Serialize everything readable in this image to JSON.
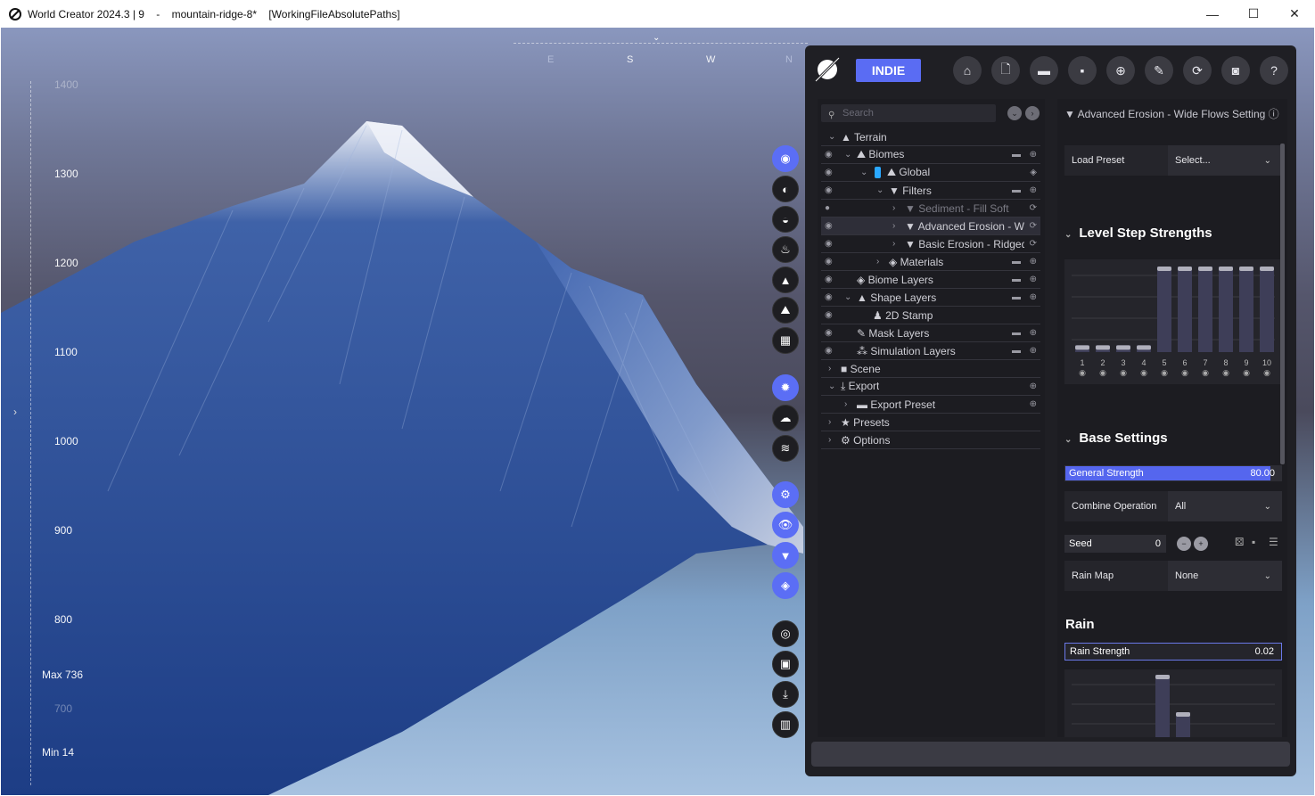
{
  "window": {
    "title": "World Creator 2024.3 | 9    -    mountain-ridge-8*    [WorkingFileAbsolutePaths]",
    "minimize": "—",
    "maximize": "☐",
    "close": "✕"
  },
  "ruler": {
    "labels": [
      "1400",
      "1300",
      "1200",
      "1100",
      "1000",
      "900",
      "800",
      "700"
    ],
    "max": "Max 736",
    "min": "Min 14"
  },
  "compass": [
    "E",
    "S",
    "W",
    "N"
  ],
  "toolbar": {
    "brand": "INDIE",
    "buttons": [
      "home-icon",
      "new-file-icon",
      "open-folder-icon",
      "save-icon",
      "save-as-icon",
      "export-icon",
      "sync-icon",
      "camera-icon",
      "help-icon"
    ]
  },
  "tree": {
    "search_placeholder": "Search",
    "rows": [
      {
        "label": "Terrain"
      },
      {
        "label": "Biomes"
      },
      {
        "label": "Global"
      },
      {
        "label": "Filters"
      },
      {
        "label": "Sediment - Fill Soft"
      },
      {
        "label": "Advanced Erosion - W"
      },
      {
        "label": "Basic Erosion - Ridged"
      },
      {
        "label": "Materials"
      },
      {
        "label": "Biome Layers"
      },
      {
        "label": "Shape Layers"
      },
      {
        "label": "2D Stamp"
      },
      {
        "label": "Mask Layers"
      },
      {
        "label": "Simulation Layers"
      },
      {
        "label": "Scene"
      },
      {
        "label": "Export"
      },
      {
        "label": "Export Preset"
      },
      {
        "label": "Presets"
      },
      {
        "label": "Options"
      }
    ]
  },
  "props": {
    "header": "Advanced Erosion - Wide Flows Setting",
    "load_preset_label": "Load Preset",
    "load_preset_value": "Select...",
    "level_step_title": "Level Step Strengths",
    "level_steps": [
      "1",
      "2",
      "3",
      "4",
      "5",
      "6",
      "7",
      "8",
      "9",
      "10"
    ],
    "level_values": [
      0.08,
      0.08,
      0.08,
      0.08,
      1,
      1,
      1,
      1,
      1,
      1
    ],
    "base_title": "Base Settings",
    "general_strength_label": "General Strength",
    "general_strength_value": "80.00",
    "general_strength_fraction": 0.8,
    "combine_label": "Combine Operation",
    "combine_value": "All",
    "seed_label": "Seed",
    "seed_value": "0",
    "rain_map_label": "Rain Map",
    "rain_map_value": "None",
    "rain_title": "Rain",
    "rain_strength_label": "Rain Strength",
    "rain_strength_value": "0.02",
    "rain_values": [
      1,
      0.4
    ]
  }
}
